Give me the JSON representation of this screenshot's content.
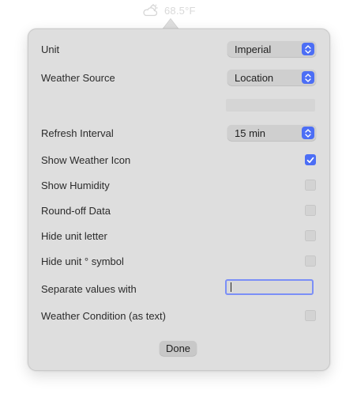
{
  "menubar": {
    "temperature": "68.5°F",
    "icon": "cloud-sun-icon"
  },
  "settings": {
    "unit": {
      "label": "Unit",
      "value": "Imperial"
    },
    "weather_source": {
      "label": "Weather Source",
      "value": "Location"
    },
    "refresh_interval": {
      "label": "Refresh Interval",
      "value": "15 min"
    },
    "show_weather_icon": {
      "label": "Show Weather Icon",
      "checked": true
    },
    "show_humidity": {
      "label": "Show Humidity",
      "checked": false
    },
    "round_off_data": {
      "label": "Round-off Data",
      "checked": false
    },
    "hide_unit_letter": {
      "label": "Hide unit letter",
      "checked": false
    },
    "hide_unit_symbol": {
      "label": "Hide unit ° symbol",
      "checked": false
    },
    "separate_values_with": {
      "label": "Separate values with",
      "value": ""
    },
    "weather_condition_text": {
      "label": "Weather Condition (as text)",
      "checked": false
    }
  },
  "done_label": "Done",
  "colors": {
    "accent": "#4c6ef5",
    "popover_bg": "#dedede",
    "text": "#2b2b2b"
  }
}
